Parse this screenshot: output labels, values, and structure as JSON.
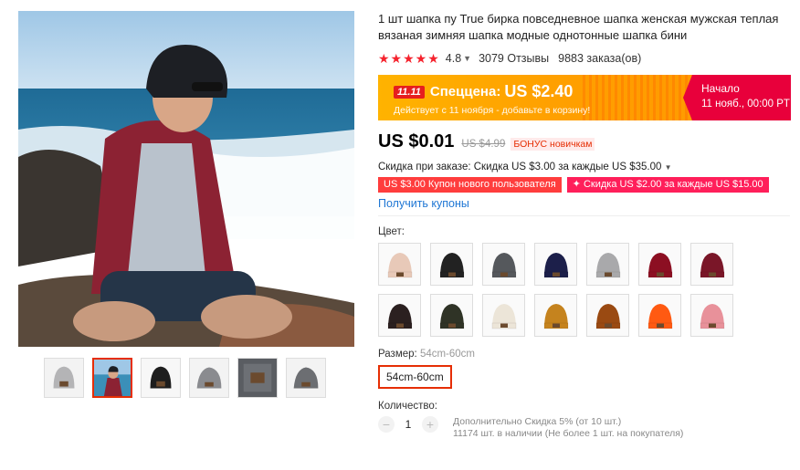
{
  "product": {
    "title": "1 шт шапка пу True бирка повседневное шапка женская мужская теплая вязаная зимняя шапка модные однотонные шапка бини",
    "rating": "4.8",
    "reviews": "3079 Отзывы",
    "orders": "9883 заказа(ов)"
  },
  "promo": {
    "badge": "11.11",
    "label": "Спеццена:",
    "price": "US $2.40",
    "note": "Действует с 11 ноября - добавьте в корзину!",
    "start_label": "Начало",
    "start_date": "11 нояб., 00:00 PT"
  },
  "pricing": {
    "price": "US $0.01",
    "old_price": "US $4.99",
    "bonus": "БОНУС новичкам"
  },
  "discount": {
    "text": "Скидка при заказе: Скидка US $3.00 за каждые US $35.00",
    "coupon1": "US $3.00 Купон нового пользователя",
    "coupon2": "✦ Скидка US $2.00 за каждые US $15.00",
    "get_coupons": "Получить купоны"
  },
  "colors": {
    "label": "Цвет:",
    "swatches": [
      "#e8c9b8",
      "#222222",
      "#55585c",
      "#1c1f4a",
      "#a9a9ab",
      "#8c0f22",
      "#7a1628",
      "#2b2020",
      "#2f3326",
      "#ece5d8",
      "#c5831e",
      "#9a4a12",
      "#ff5a12",
      "#e8919a"
    ]
  },
  "size": {
    "label": "Размер:",
    "selected": "54cm-60cm",
    "option": "54cm-60cm"
  },
  "quantity": {
    "label": "Количество:",
    "minus": "−",
    "value": "1",
    "plus": "+",
    "extra_discount": "Дополнительно Скидка 5% (от 10 шт.)",
    "stock": "11174 шт. в наличии (Не более 1 шт. на покупателя)"
  },
  "icons": {
    "stars": "star-icon",
    "chevron": "chevron-down-icon"
  },
  "colors_theme": {
    "accent": "#e62e04",
    "link": "#1e76d4",
    "promo_orange": "#ffa000",
    "promo_red": "#e8003b"
  }
}
